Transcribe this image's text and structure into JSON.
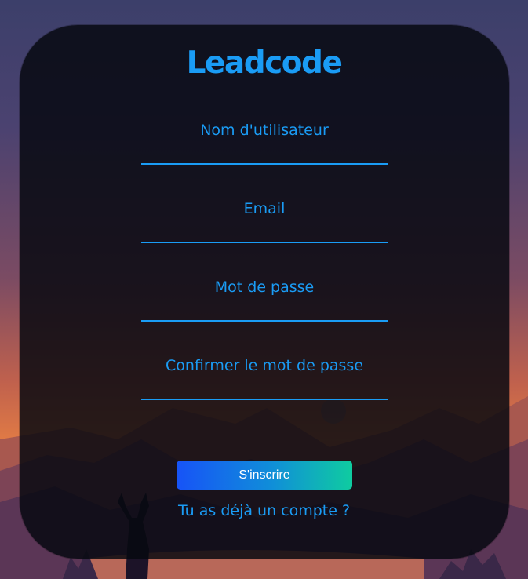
{
  "brand": {
    "title": "Leadcode"
  },
  "form": {
    "fields": [
      {
        "label": "Nom d'utilisateur",
        "value": ""
      },
      {
        "label": "Email",
        "value": ""
      },
      {
        "label": "Mot de passe",
        "value": ""
      },
      {
        "label": "Confirmer le mot de passe",
        "value": ""
      }
    ],
    "submit_label": "S'inscrire",
    "login_link": "Tu as déjà un compte ?"
  },
  "colors": {
    "accent": "#1a9cf5",
    "button_start": "#1753f7",
    "button_end": "#0fcca0",
    "card": "#06080f"
  }
}
